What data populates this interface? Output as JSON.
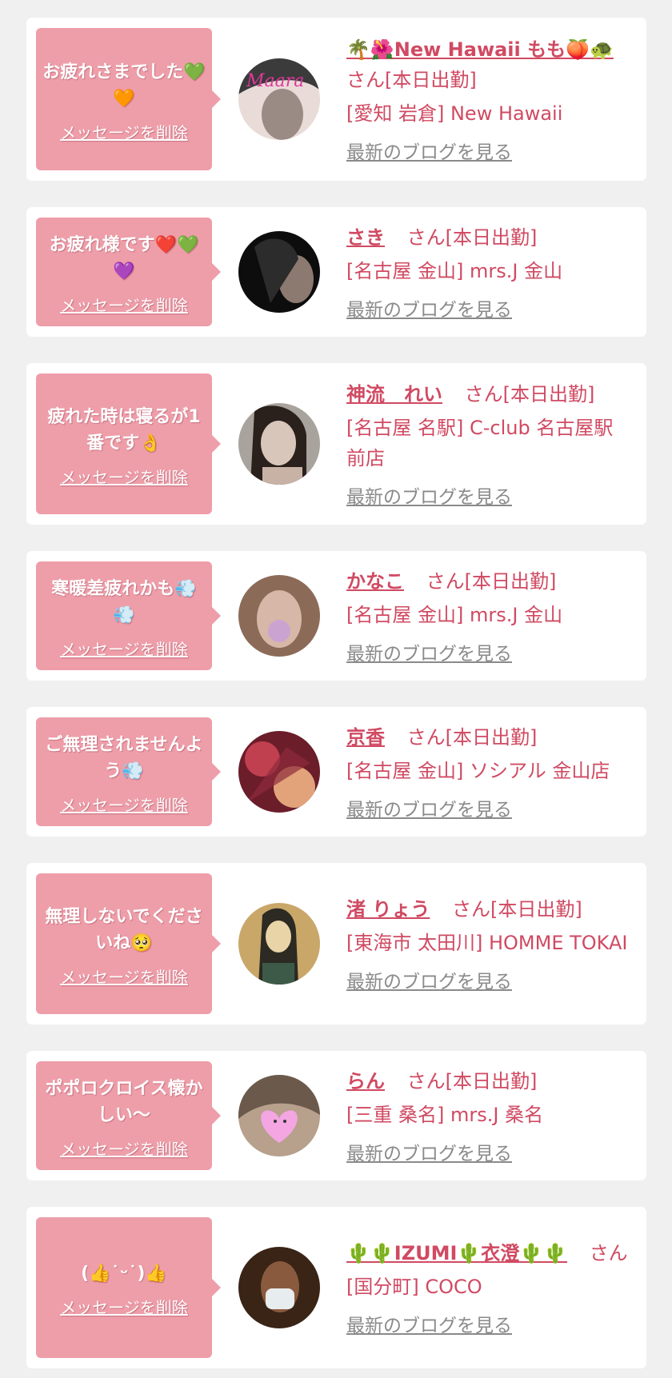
{
  "delete_label": "メッセージを削除",
  "blog_label": "最新のブログを見る",
  "suffix": "さん[本日出勤]",
  "cards": [
    {
      "message": "お疲れさまでした💚🧡",
      "name": "🌴🌺New Hawaii もも🍑🐢",
      "suffix": "さん[本日出勤]",
      "shop": "[愛知 岩倉] New Hawaii",
      "avatar_colors": [
        "#3b3b3b",
        "#9a8b85",
        "#e9dcd8"
      ]
    },
    {
      "message": "お疲れ様です❤️💚💜",
      "name": "さき",
      "suffix": "さん[本日出勤]",
      "shop": "[名古屋 金山] mrs.J 金山",
      "avatar_colors": [
        "#0d0d0d",
        "#2c2c2c",
        "#8c7a70"
      ]
    },
    {
      "message": "疲れた時は寝るが1番です👌",
      "name": "神流　れい",
      "suffix": "さん[本日出勤]",
      "shop": "[名古屋 名駅] C-club 名古屋駅前店",
      "avatar_colors": [
        "#a8a39d",
        "#6e5b51",
        "#d9c6ba"
      ]
    },
    {
      "message": "寒暖差疲れかも💨💨",
      "name": "かなこ",
      "suffix": "さん[本日出勤]",
      "shop": "[名古屋 金山] mrs.J 金山",
      "avatar_colors": [
        "#8b6b58",
        "#d6b7a8",
        "#c9a0d8"
      ]
    },
    {
      "message": "ご無理されませんよう💨",
      "name": "京香",
      "suffix": "さん[本日出勤]",
      "shop": "[名古屋 金山] ソシアル 金山店",
      "avatar_colors": [
        "#6b1d2a",
        "#c04050",
        "#e2a37b"
      ]
    },
    {
      "message": "無理しないでくださいね🥺",
      "name": "渚 りょう",
      "suffix": "さん[本日出勤]",
      "shop": "[東海市 太田川] HOMME TOKAI",
      "avatar_colors": [
        "#c9a769",
        "#2c2a22",
        "#e9d4a8"
      ]
    },
    {
      "message": "ポポロクロイス懐かしい〜",
      "name": "らん",
      "suffix": "さん[本日出勤]",
      "shop": "[三重 桑名] mrs.J 桑名",
      "avatar_colors": [
        "#6b5a4c",
        "#b7a08c",
        "#f3a6e2"
      ]
    },
    {
      "message": "(👍˙ᵕ˙)👍",
      "name": "🌵🌵IZUMI🌵衣澄🌵🌵",
      "suffix": "さん",
      "shop": "[国分町] COCO",
      "avatar_colors": [
        "#3a2416",
        "#8a5a3e",
        "#e7ecef"
      ]
    }
  ]
}
